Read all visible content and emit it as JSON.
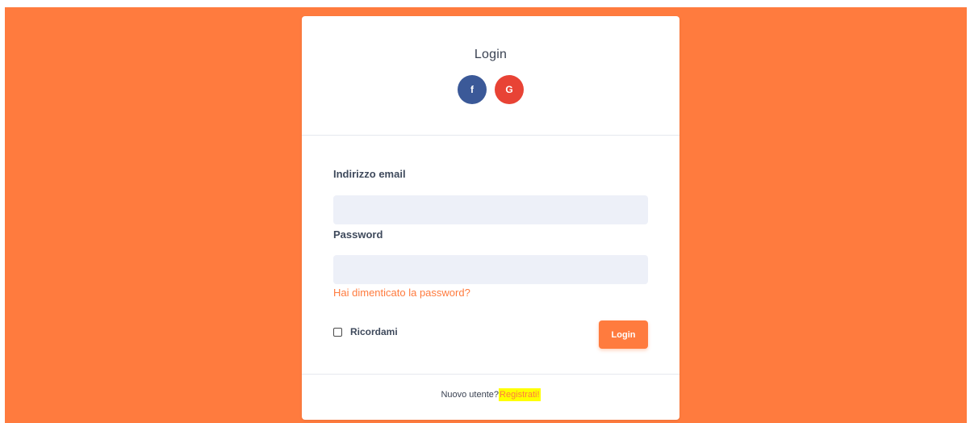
{
  "login_card": {
    "title": "Login",
    "social": {
      "facebook_label": "f",
      "google_label": "G"
    },
    "email": {
      "label": "Indirizzo email",
      "value": "",
      "placeholder": ""
    },
    "password": {
      "label": "Password",
      "value": "",
      "placeholder": ""
    },
    "forgot_link": "Hai dimenticato la password?",
    "remember": {
      "label": "Ricordami",
      "checked": false
    },
    "login_button": "Login",
    "footer": {
      "prompt": "Nuovo utente?",
      "register_link": "Registrati!"
    }
  },
  "colors": {
    "accent": "#ff7b3e",
    "facebook": "#3b5998",
    "google": "#e84335",
    "input_bg": "#edf0f8",
    "highlight": "#ffff00"
  }
}
